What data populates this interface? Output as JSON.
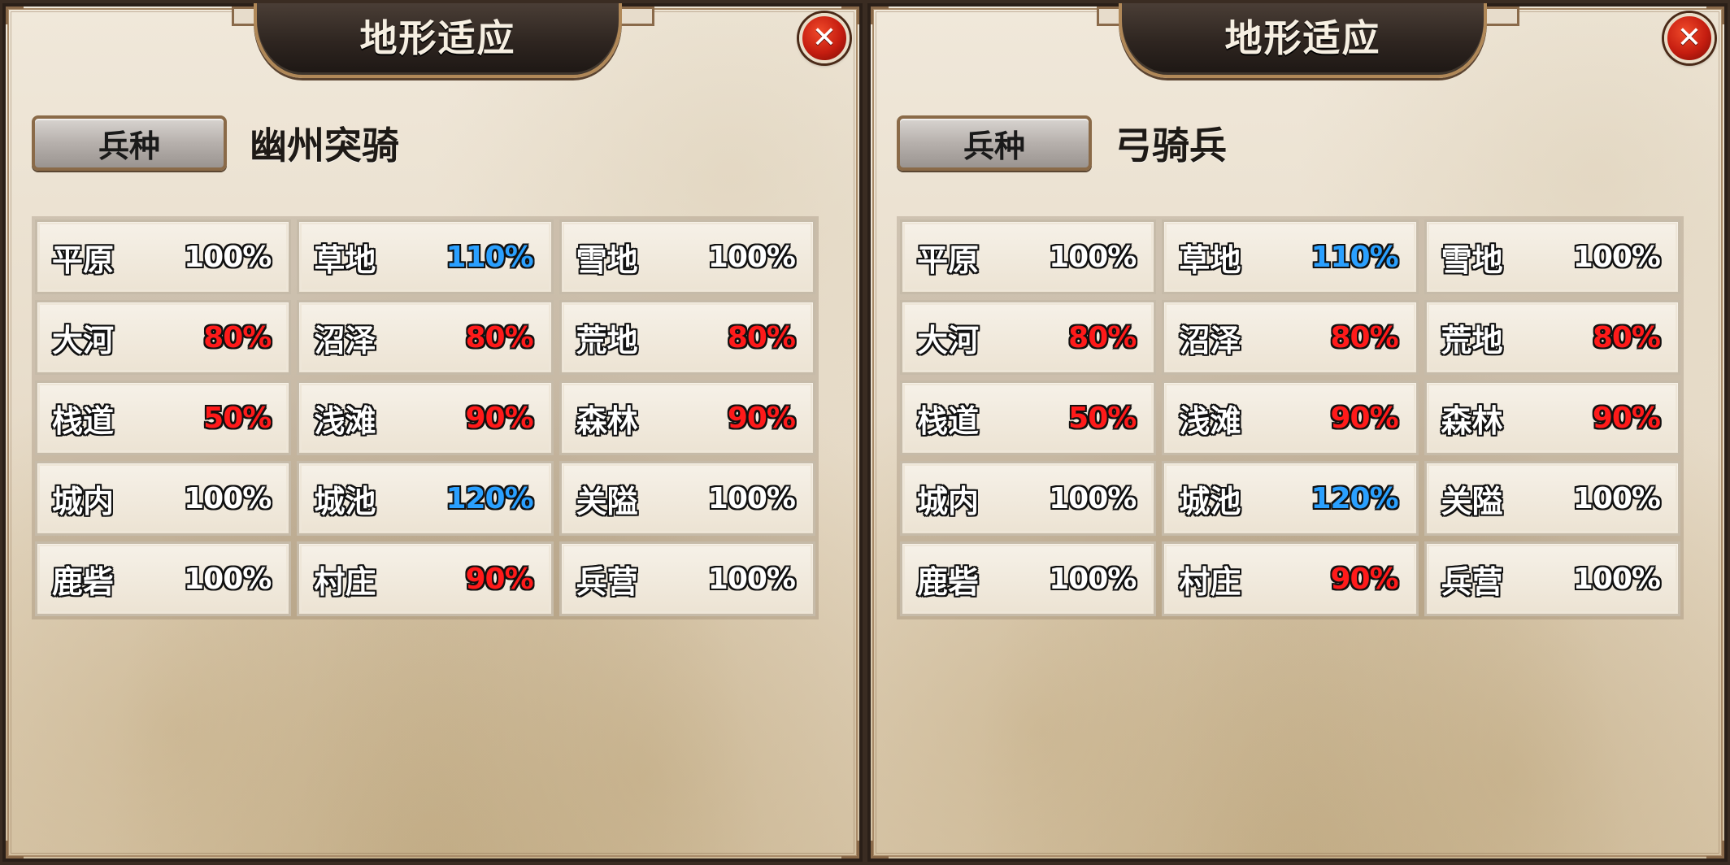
{
  "panels": [
    {
      "title": "地形适应",
      "unit_button_label": "兵种",
      "unit_name": "幽州突骑",
      "close_icon": "✕",
      "terrain": [
        {
          "name": "平原",
          "value": "100%",
          "tone": "normal"
        },
        {
          "name": "草地",
          "value": "110%",
          "tone": "good"
        },
        {
          "name": "雪地",
          "value": "100%",
          "tone": "normal"
        },
        {
          "name": "大河",
          "value": "80%",
          "tone": "bad"
        },
        {
          "name": "沼泽",
          "value": "80%",
          "tone": "bad"
        },
        {
          "name": "荒地",
          "value": "80%",
          "tone": "bad"
        },
        {
          "name": "栈道",
          "value": "50%",
          "tone": "bad"
        },
        {
          "name": "浅滩",
          "value": "90%",
          "tone": "bad"
        },
        {
          "name": "森林",
          "value": "90%",
          "tone": "bad"
        },
        {
          "name": "城内",
          "value": "100%",
          "tone": "normal"
        },
        {
          "name": "城池",
          "value": "120%",
          "tone": "good"
        },
        {
          "name": "关隘",
          "value": "100%",
          "tone": "normal"
        },
        {
          "name": "鹿砦",
          "value": "100%",
          "tone": "normal"
        },
        {
          "name": "村庄",
          "value": "90%",
          "tone": "bad"
        },
        {
          "name": "兵营",
          "value": "100%",
          "tone": "normal"
        }
      ]
    },
    {
      "title": "地形适应",
      "unit_button_label": "兵种",
      "unit_name": "弓骑兵",
      "close_icon": "✕",
      "terrain": [
        {
          "name": "平原",
          "value": "100%",
          "tone": "normal"
        },
        {
          "name": "草地",
          "value": "110%",
          "tone": "good"
        },
        {
          "name": "雪地",
          "value": "100%",
          "tone": "normal"
        },
        {
          "name": "大河",
          "value": "80%",
          "tone": "bad"
        },
        {
          "name": "沼泽",
          "value": "80%",
          "tone": "bad"
        },
        {
          "name": "荒地",
          "value": "80%",
          "tone": "bad"
        },
        {
          "name": "栈道",
          "value": "50%",
          "tone": "bad"
        },
        {
          "name": "浅滩",
          "value": "90%",
          "tone": "bad"
        },
        {
          "name": "森林",
          "value": "90%",
          "tone": "bad"
        },
        {
          "name": "城内",
          "value": "100%",
          "tone": "normal"
        },
        {
          "name": "城池",
          "value": "120%",
          "tone": "good"
        },
        {
          "name": "关隘",
          "value": "100%",
          "tone": "normal"
        },
        {
          "name": "鹿砦",
          "value": "100%",
          "tone": "normal"
        },
        {
          "name": "村庄",
          "value": "90%",
          "tone": "bad"
        },
        {
          "name": "兵营",
          "value": "100%",
          "tone": "normal"
        }
      ]
    }
  ],
  "colors": {
    "value_normal": "#ffffff",
    "value_bad": "#ff1a1a",
    "value_good": "#2aa0ff",
    "title_plaque": "#2e2520",
    "close_button": "#c51d10"
  }
}
